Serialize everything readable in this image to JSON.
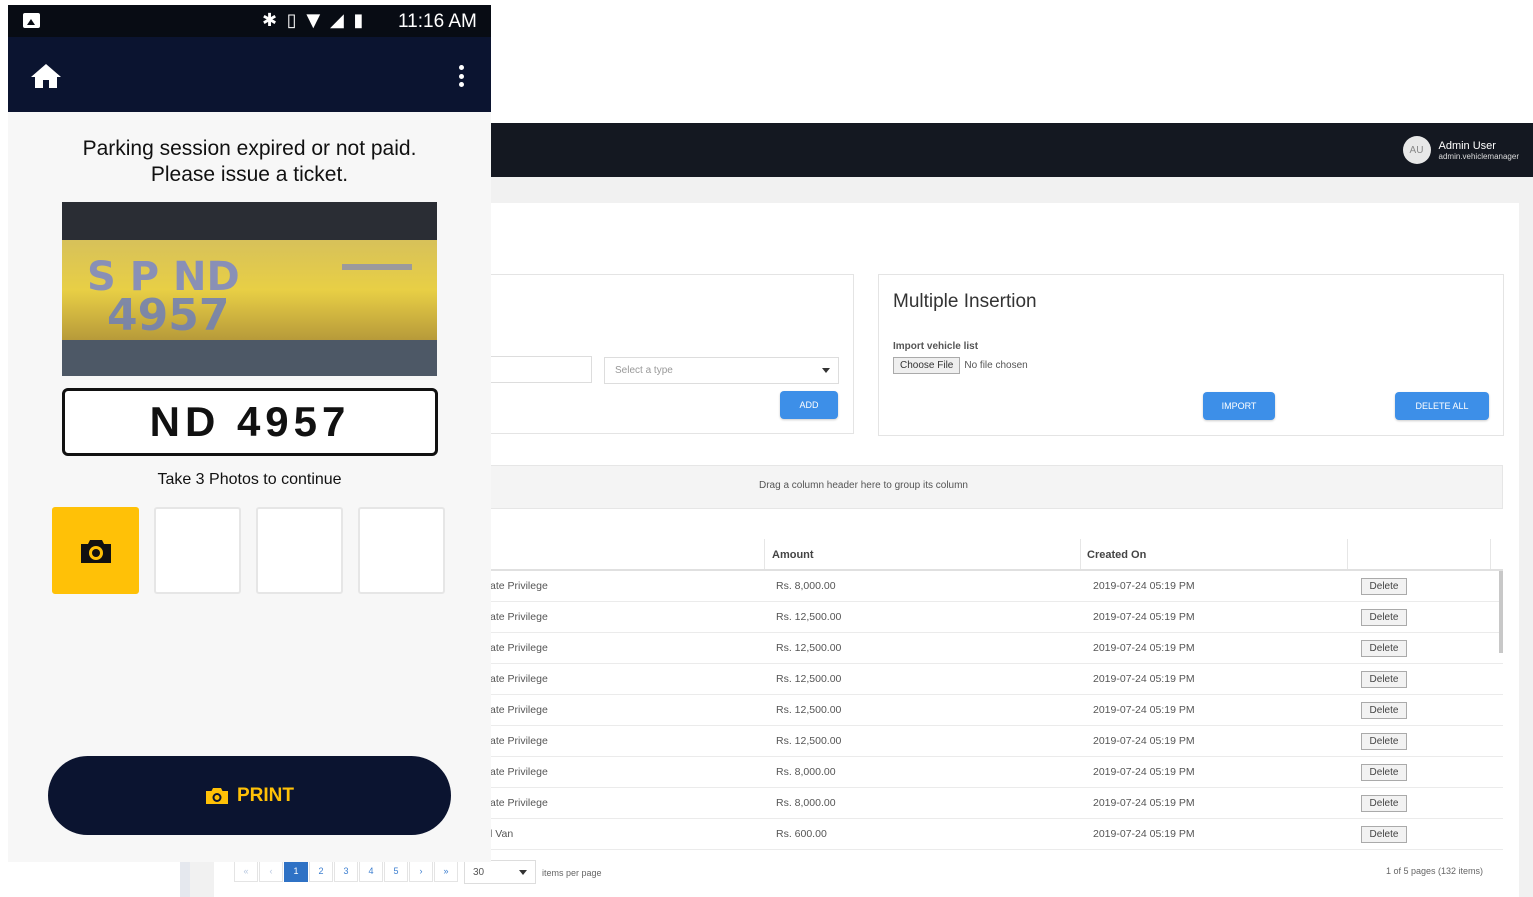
{
  "phone": {
    "status": {
      "time": "11:16 AM",
      "icons": "✱ ▯ ▼ ◢ ▮"
    },
    "message_line1": "Parking session expired or not paid.",
    "message_line2": "Please issue a ticket.",
    "plate_number": "ND 4957",
    "take_photos": "Take 3 Photos to continue",
    "print_label": "PRINT",
    "colors": {
      "appbar": "#0b1430",
      "accent": "#ffc107"
    }
  },
  "web": {
    "user": {
      "avatar": "AU",
      "name": "Admin User",
      "email": "admin.vehiclemanager"
    },
    "single": {
      "type_placeholder": "Select a type",
      "add_label": "ADD"
    },
    "multi": {
      "title": "Multiple Insertion",
      "import_label": "Import vehicle list",
      "choose_file": "Choose File",
      "no_file": "No file chosen",
      "import_btn": "IMPORT",
      "delete_all_btn": "DELETE ALL"
    },
    "group_hint": "Drag a column header here to group its column",
    "columns": {
      "amount": "Amount",
      "created": "Created On"
    },
    "rows": [
      {
        "type": "ate Privilege",
        "amount": "Rs. 8,000.00",
        "created": "2019-07-24 05:19 PM",
        "action": "Delete"
      },
      {
        "type": "ate Privilege",
        "amount": "Rs. 12,500.00",
        "created": "2019-07-24 05:19 PM",
        "action": "Delete"
      },
      {
        "type": "ate Privilege",
        "amount": "Rs. 12,500.00",
        "created": "2019-07-24 05:19 PM",
        "action": "Delete"
      },
      {
        "type": "ate Privilege",
        "amount": "Rs. 12,500.00",
        "created": "2019-07-24 05:19 PM",
        "action": "Delete"
      },
      {
        "type": "ate Privilege",
        "amount": "Rs. 12,500.00",
        "created": "2019-07-24 05:19 PM",
        "action": "Delete"
      },
      {
        "type": "ate Privilege",
        "amount": "Rs. 12,500.00",
        "created": "2019-07-24 05:19 PM",
        "action": "Delete"
      },
      {
        "type": "ate Privilege",
        "amount": "Rs. 8,000.00",
        "created": "2019-07-24 05:19 PM",
        "action": "Delete"
      },
      {
        "type": "ate Privilege",
        "amount": "Rs. 8,000.00",
        "created": "2019-07-24 05:19 PM",
        "action": "Delete"
      },
      {
        "type": "l Van",
        "amount": "Rs. 600.00",
        "created": "2019-07-24 05:19 PM",
        "action": "Delete"
      }
    ],
    "pager": {
      "first": "«",
      "prev": "‹",
      "pages": [
        "1",
        "2",
        "3",
        "4",
        "5"
      ],
      "current": "1",
      "next": "›",
      "last": "»",
      "per_page": "30",
      "per_page_label": "items per page",
      "info": "1 of 5 pages (132 items)"
    }
  }
}
